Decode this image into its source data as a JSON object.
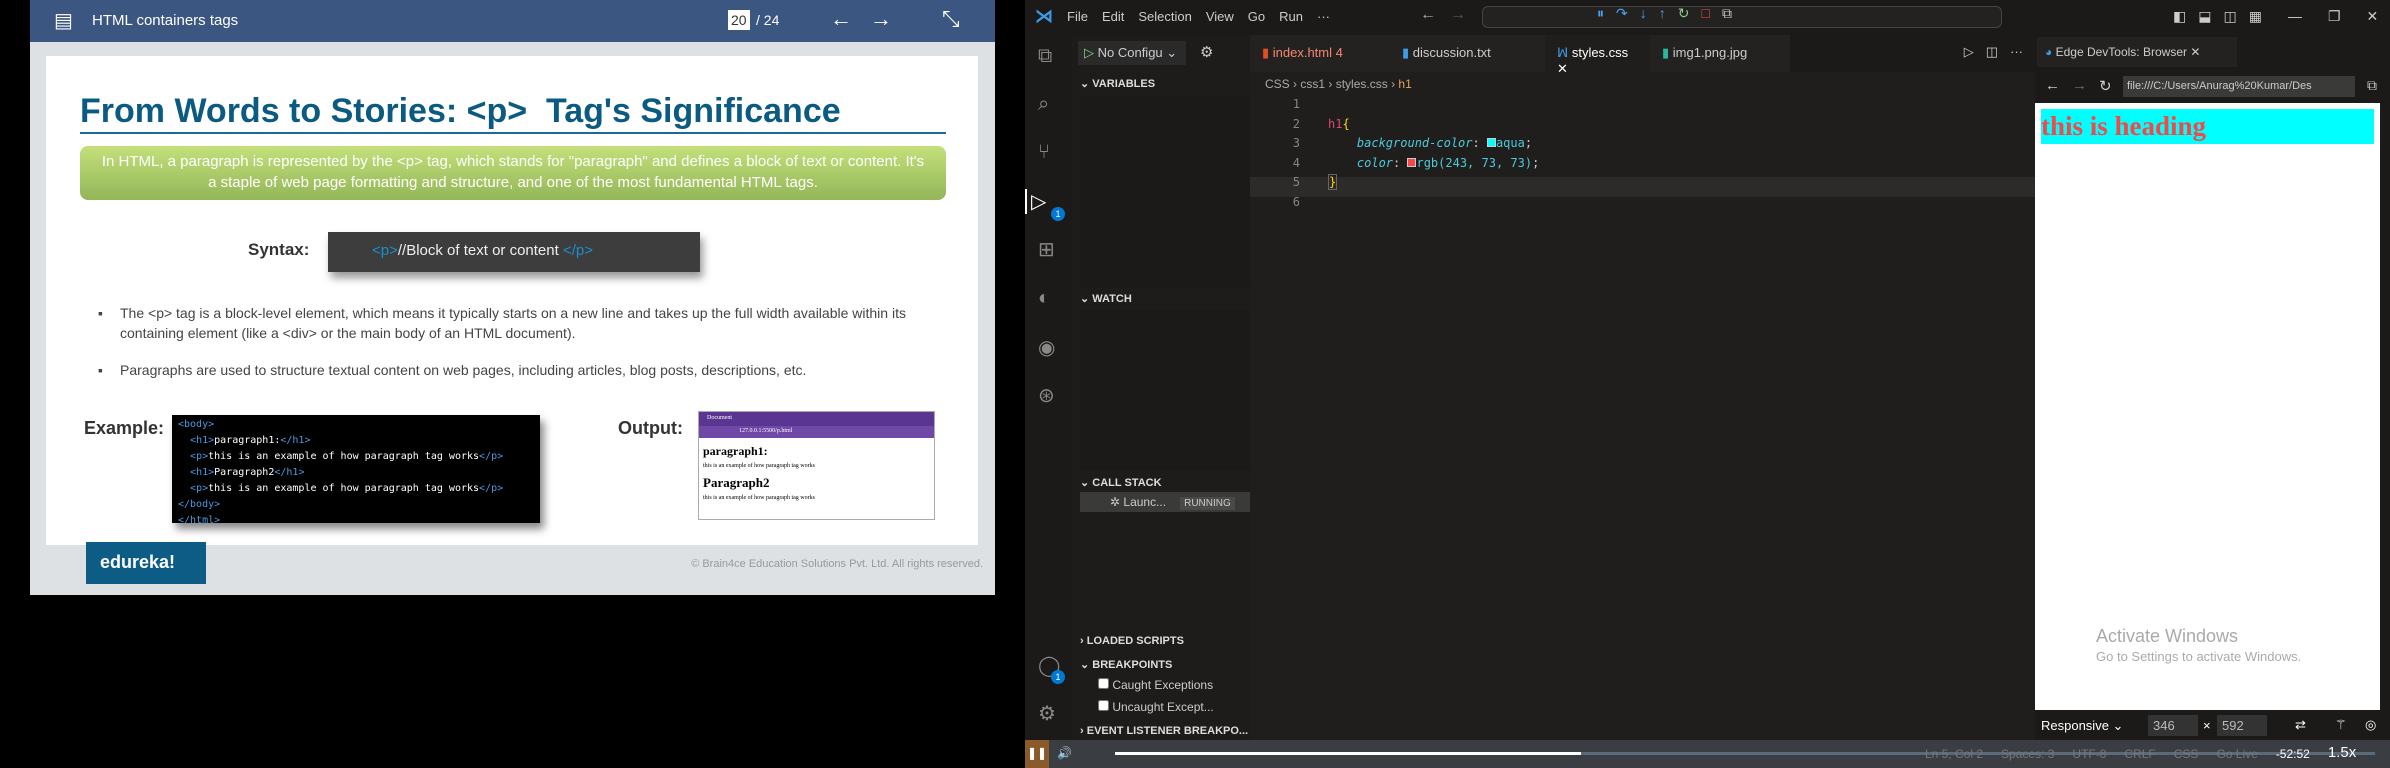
{
  "slide": {
    "header_title": "HTML containers tags",
    "page_current": "20",
    "page_total": "/ 24",
    "title": "From Words to Stories: <p>  Tag's Significance",
    "intro": "In HTML, a paragraph is represented by the <p> tag, which stands for \"paragraph\" and defines a block of text or content. It's a staple of web page formatting and structure, and one of the most fundamental HTML tags.",
    "syntax_label": "Syntax:",
    "syntax_open": "<p>",
    "syntax_text": "//Block of text or content ",
    "syntax_close": "</p>",
    "bullets": [
      "The <p> tag is a block-level element, which means it typically starts on a new line and takes up the full width available within its containing element (like a <div> or the main body of an HTML document).",
      "Paragraphs are used to structure textual content on web pages, including articles, blog posts, descriptions, etc."
    ],
    "example_label": "Example:",
    "output_label": "Output:",
    "code_lines": [
      "<body>",
      "  <h1>paragraph1:</h1>",
      "  <p>this is an example of how paragraph tag works</p>",
      "  <h1>Paragraph2</h1>",
      "  <p>this is an example of how paragraph tag works</p>",
      "</body>",
      "</html>"
    ],
    "output": {
      "tab": "Document",
      "url": "127.0.0.1:5500/p.html",
      "h1a": "paragraph1:",
      "pa": "this is an example of how paragraph tag works",
      "h1b": "Paragraph2",
      "pb": "this is an example of how paragraph tag works"
    },
    "logo": "edureka!",
    "copyright": "© Brain4ce Education Solutions Pvt. Ltd. All rights reserved."
  },
  "vscode": {
    "menu": [
      "File",
      "Edit",
      "Selection",
      "View",
      "Go",
      "Run",
      "···"
    ],
    "run_config": "No Configu",
    "tabs": [
      {
        "label": "index.html",
        "badge": "4"
      },
      {
        "label": "discussion.txt"
      },
      {
        "label": "styles.css"
      },
      {
        "label": "img1.png.jpg"
      }
    ],
    "breadcrumb": [
      "CSS",
      "css1",
      "styles.css",
      "h1"
    ],
    "code": [
      {
        "n": "1"
      },
      {
        "n": "2",
        "sel": "h1",
        "brace": "{"
      },
      {
        "n": "3",
        "prop": "background-color",
        "val": "aqua",
        "swatch": "#00ffff"
      },
      {
        "n": "4",
        "prop": "color",
        "val": "rgb(243, 73, 73)",
        "swatch": "#f34949"
      },
      {
        "n": "5",
        "brace": "}"
      },
      {
        "n": "6"
      }
    ],
    "sections": {
      "variables": "VARIABLES",
      "watch": "WATCH",
      "call_stack": "CALL STACK",
      "loaded": "LOADED SCRIPTS",
      "breakpoints": "BREAKPOINTS",
      "event": "EVENT LISTENER BREAKPO..."
    },
    "launch": "Launc...",
    "running": "RUNNING",
    "bp": [
      "Caught Exceptions",
      "Uncaught Except..."
    ],
    "badge": "1",
    "status": {
      "pos": "Ln 5, Col 2",
      "spaces": "Spaces: 3",
      "enc": "UTF-8",
      "eol": "CRLF",
      "lang": "CSS",
      "live": "Go Live",
      "time": "-52:52",
      "speed": "1.5x"
    },
    "browser": {
      "tab": "Edge DevTools: Browser",
      "url": "file:///C:/Users/Anurag%20Kumar/Des",
      "heading": "this is heading",
      "device": "Responsive",
      "w": "346",
      "h": "592",
      "x": "×"
    },
    "watermark": [
      "Activate Windows",
      "Go to Settings to activate Windows."
    ]
  },
  "progress": 0.37
}
